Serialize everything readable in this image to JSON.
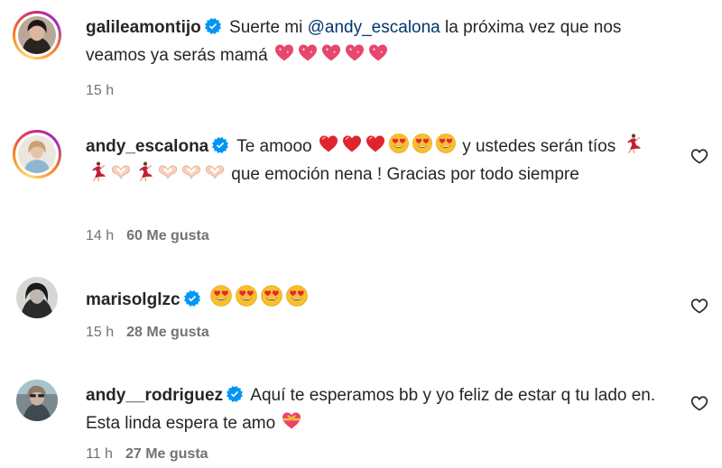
{
  "comments": [
    {
      "username": "galileamontijo",
      "segments": [
        "Suerte mi ",
        "@andy_escalona",
        " la próxima vez que nos veamos ya serás mamá"
      ],
      "time": "15 h",
      "likes": ""
    },
    {
      "username": "andy_escalona",
      "segments": [
        "Te amooo",
        "y ustedes serán tíos",
        "que emoción nena ! Gracias por todo siempre"
      ],
      "time": "14 h",
      "likes": "60 Me gusta"
    },
    {
      "username": "marisolglzc",
      "time": "15 h",
      "likes": "28 Me gusta"
    },
    {
      "username": "andy__rodriguez",
      "segments": [
        "Aquí te esperamos bb y yo feliz de estar q tu lado en. Esta linda espera te amo"
      ],
      "time": "11 h",
      "likes": "27 Me gusta"
    }
  ],
  "icons": {
    "verified": "verified-badge-icon",
    "like": "heart-outline-icon",
    "emoji_heart": "sparkling-heart-emoji",
    "emoji_red_heart": "red-heart-emoji",
    "emoji_heart_eyes": "heart-eyes-emoji",
    "emoji_dancer": "dancer-emoji",
    "emoji_heart_hands": "heart-hands-emoji",
    "emoji_heart_ribbon": "heart-with-ribbon-emoji"
  },
  "colors": {
    "text": "#262626",
    "muted": "#737373",
    "mention": "#00376b",
    "verified": "#0095f6",
    "background": "#ffffff"
  }
}
